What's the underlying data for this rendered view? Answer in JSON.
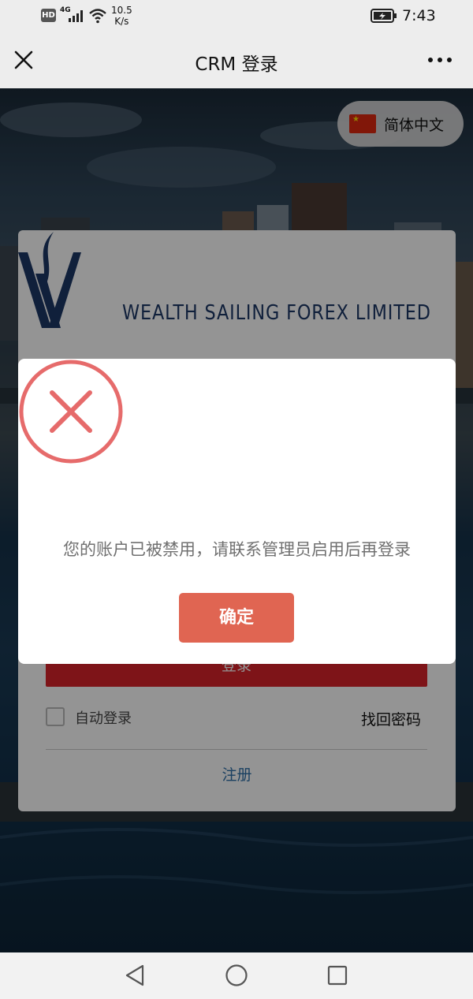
{
  "status_bar": {
    "hd": "HD",
    "network": "4G",
    "speed_value": "10.5",
    "speed_unit": "K/s",
    "time": "7:43"
  },
  "nav": {
    "title": "CRM 登录",
    "close_icon": "close-icon",
    "more_icon": "more-icon"
  },
  "language": {
    "label": "简体中文",
    "flag_icon": "china-flag-icon"
  },
  "login": {
    "company_name": "WEALTH SAILING FOREX LIMITED",
    "login_button": "登录",
    "auto_login_label": "自动登录",
    "forgot_password": "找回密码",
    "register": "注册"
  },
  "dialog": {
    "icon": "error-x-icon",
    "message": "您的账户已被禁用，请联系管理员启用后再登录",
    "confirm_button": "确定"
  },
  "system_nav": {
    "back_icon": "back-triangle-icon",
    "home_icon": "home-circle-icon",
    "recents_icon": "recents-square-icon"
  },
  "colors": {
    "accent_red": "#d9232a",
    "dialog_button": "#e06552",
    "error_icon": "#e66b6b",
    "link_blue": "#2d6fa8",
    "brand_navy": "#1d3766"
  }
}
